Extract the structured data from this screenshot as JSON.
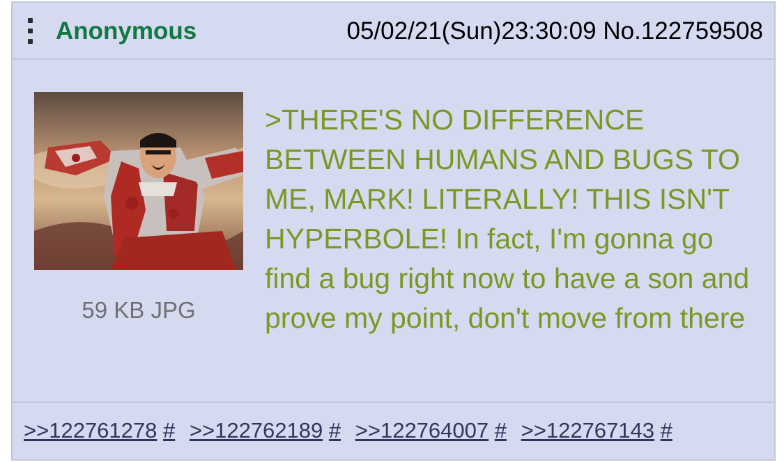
{
  "post": {
    "name": "Anonymous",
    "datetime": "05/02/21(Sun)23:30:09",
    "number_label": "No.",
    "number": "122759508",
    "file_info": "59 KB JPG",
    "comment": ">THERE'S NO DIFFERENCE BETWEEN HUMANS AND BUGS TO ME, MARK! LITERALLY! THIS ISN'T HYPERBOLE! In fact, I'm gonna go find a bug right now to have a son and prove my point, don't move from there",
    "replies": [
      {
        "link": ">>122761278",
        "hash": "#"
      },
      {
        "link": ">>122762189",
        "hash": "#"
      },
      {
        "link": ">>122764007",
        "hash": "#"
      },
      {
        "link": ">>122767143",
        "hash": "#"
      }
    ]
  },
  "colors": {
    "post_background": "#d6daf0",
    "border": "#c2c6da",
    "name": "#117743",
    "greentext": "#789922",
    "link": "#34345c",
    "file_info": "#707070"
  },
  "icons": {
    "menu": "vertical-dots-icon"
  }
}
